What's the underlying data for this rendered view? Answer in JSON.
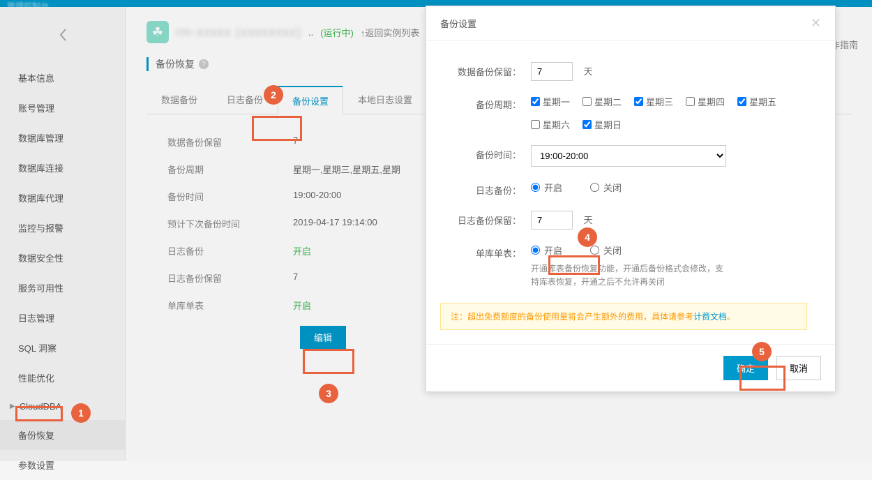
{
  "topbar": {
    "console": "管理控制台"
  },
  "sidebar": {
    "items": [
      {
        "label": "基本信息"
      },
      {
        "label": "账号管理"
      },
      {
        "label": "数据库管理"
      },
      {
        "label": "数据库连接"
      },
      {
        "label": "数据库代理"
      },
      {
        "label": "监控与报警"
      },
      {
        "label": "数据安全性"
      },
      {
        "label": "服务可用性"
      },
      {
        "label": "日志管理"
      },
      {
        "label": "SQL 洞察"
      },
      {
        "label": "性能优化"
      },
      {
        "label": "CloudDBA",
        "caret": true
      },
      {
        "label": "备份恢复",
        "active": true
      },
      {
        "label": "参数设置"
      }
    ]
  },
  "header": {
    "title_masked": "rm-xxxxx (xxxxxxxx)",
    "status": "(运行中)",
    "return": "↑返回实例列表",
    "operate": "操作指南"
  },
  "section": {
    "title": "备份恢复"
  },
  "tabs": [
    {
      "label": "数据备份"
    },
    {
      "label": "日志备份"
    },
    {
      "label": "备份设置",
      "active": true
    },
    {
      "label": "本地日志设置"
    }
  ],
  "info": {
    "rows": [
      {
        "label": "数据备份保留",
        "value": "7"
      },
      {
        "label": "备份周期",
        "value": "星期一,星期三,星期五,星期"
      },
      {
        "label": "备份时间",
        "value": "19:00-20:00"
      },
      {
        "label": "预计下次备份时间",
        "value": "2019-04-17 19:14:00"
      },
      {
        "label": "日志备份",
        "value": "开启",
        "green": true
      },
      {
        "label": "日志备份保留",
        "value": "7"
      },
      {
        "label": "单库单表",
        "value": "开启",
        "green": true
      }
    ],
    "edit": "编辑"
  },
  "modal": {
    "title": "备份设置",
    "labels": {
      "data_retain": "数据备份保留：",
      "cycle": "备份周期：",
      "time": "备份时间：",
      "log_backup": "日志备份：",
      "log_retain": "日志备份保留：",
      "single": "单库单表："
    },
    "data_retain_value": "7",
    "day_unit": "天",
    "weekdays": [
      {
        "label": "星期一",
        "checked": true
      },
      {
        "label": "星期二",
        "checked": false
      },
      {
        "label": "星期三",
        "checked": true
      },
      {
        "label": "星期四",
        "checked": false
      },
      {
        "label": "星期五",
        "checked": true
      },
      {
        "label": "星期六",
        "checked": false
      },
      {
        "label": "星期日",
        "checked": true
      }
    ],
    "time_value": "19:00-20:00",
    "radio_on": "开启",
    "radio_off": "关闭",
    "log_retain_value": "7",
    "single_hint": "开通库表备份恢复功能，开通后备份格式会修改，支持库表恢复，开通之后不允许再关闭",
    "notice_prefix": "注：",
    "notice_text": "超出免费额度的备份使用量将会产生额外的费用，具体请参考",
    "notice_link": "计费文档",
    "notice_suffix": "。",
    "ok": "确定",
    "cancel": "取消"
  },
  "badges": {
    "b1": "1",
    "b2": "2",
    "b3": "3",
    "b4": "4",
    "b5": "5"
  }
}
